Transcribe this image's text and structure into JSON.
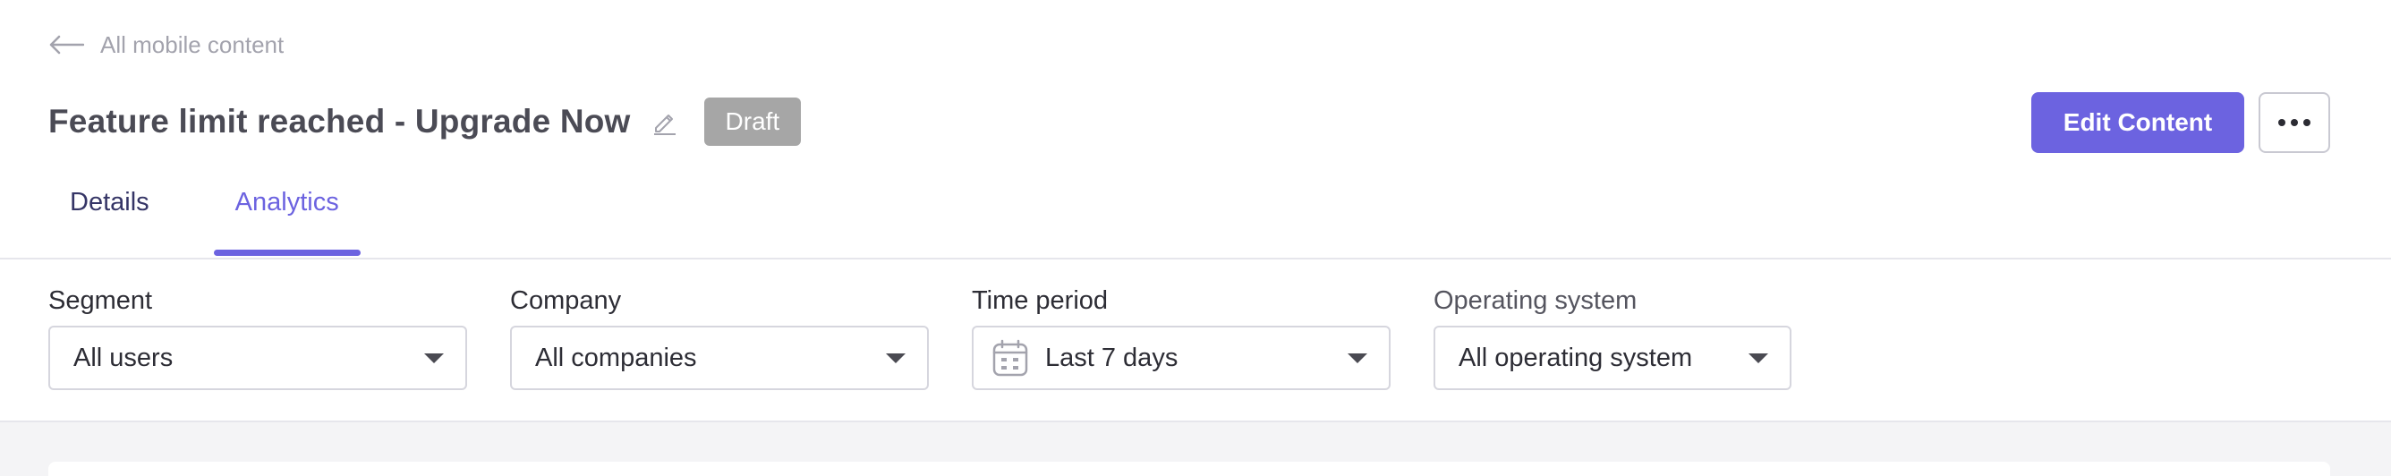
{
  "nav": {
    "back_label": "All mobile content",
    "back_icon": "arrow-left-icon"
  },
  "header": {
    "title": "Feature limit reached - Upgrade Now",
    "status_badge": "Draft",
    "edit_button": "Edit Content",
    "more_icon": "more-horizontal-icon"
  },
  "tabs": [
    {
      "label": "Details",
      "active": false
    },
    {
      "label": "Analytics",
      "active": true
    }
  ],
  "filters": {
    "segment": {
      "label": "Segment",
      "value": "All users"
    },
    "company": {
      "label": "Company",
      "value": "All companies"
    },
    "time_period": {
      "label": "Time period",
      "value": "Last 7 days",
      "icon": "calendar-icon"
    },
    "operating_system": {
      "label": "Operating system",
      "value": "All operating system"
    }
  },
  "colors": {
    "accent": "#6c63e0",
    "badge": "#a6a6a6",
    "background": "#f4f4f6"
  }
}
